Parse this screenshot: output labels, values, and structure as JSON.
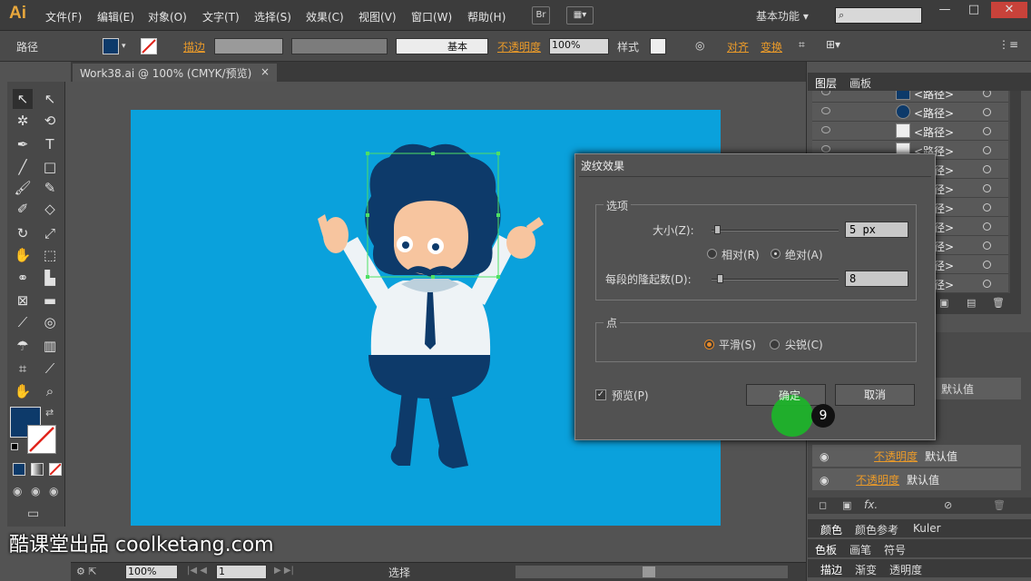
{
  "app": {
    "logo": "Ai",
    "menus": [
      "文件(F)",
      "编辑(E)",
      "对象(O)",
      "文字(T)",
      "选择(S)",
      "效果(C)",
      "视图(V)",
      "窗口(W)",
      "帮助(H)"
    ],
    "bridge_label": "Br",
    "workspace": "基本功能",
    "window_controls": [
      "—",
      "□",
      "✕"
    ]
  },
  "control_bar": {
    "selection_type": "路径",
    "stroke_label": "描边",
    "stroke_style": "基本",
    "opacity_label": "不透明度",
    "opacity_value": "100%",
    "style_label": "样式",
    "align_label": "对齐",
    "transform_label": "变换"
  },
  "document": {
    "tab_title": "Work38.ai @ 100% (CMYK/预览)",
    "tab_close": "×"
  },
  "status": {
    "zoom": "100%",
    "page": "1",
    "tool": "选择"
  },
  "watermark": "酷课堂出品 coolketang.com",
  "layers_panel": {
    "tabs": [
      "图层",
      "画板"
    ],
    "rows": [
      {
        "name": "<路径>"
      },
      {
        "name": "<路径>"
      },
      {
        "name": "<路径>"
      },
      {
        "name": "<路径>"
      },
      {
        "name": "<路径>"
      },
      {
        "name": "<路径>"
      },
      {
        "name": "<路径>"
      },
      {
        "name": "<路径>"
      },
      {
        "name": "<路径>"
      },
      {
        "name": "<路径>"
      },
      {
        "name": "<路径>"
      }
    ]
  },
  "appearance_panel": {
    "rows": [
      {
        "label": "",
        "value": "默认值"
      },
      {
        "label": "不透明度",
        "value": "默认值"
      },
      {
        "label": "不透明度",
        "value": "默认值"
      }
    ],
    "fx_label": "fx."
  },
  "color_panels": {
    "row1": [
      "颜色",
      "颜色参考",
      "Kuler"
    ],
    "row2": [
      "色板",
      "画笔",
      "符号"
    ],
    "row3": [
      "描边",
      "渐变",
      "透明度"
    ]
  },
  "dialog": {
    "title": "波纹效果",
    "options_group": "选项",
    "size_label": "大小(Z):",
    "size_value": "5 px",
    "relative_label": "相对(R)",
    "absolute_label": "绝对(A)",
    "ridges_label": "每段的隆起数(D):",
    "ridges_value": "8",
    "points_group": "点",
    "smooth_label": "平滑(S)",
    "corner_label": "尖锐(C)",
    "preview_label": "预览(P)",
    "ok_label": "确定",
    "cancel_label": "取消",
    "step_badge": "9"
  },
  "colors": {
    "canvas_bg": "#0aa1dc",
    "hair": "#0d3a6a",
    "skin": "#f7c59f",
    "highlight_green": "#1db32a",
    "accent_orange": "#e99a2a"
  }
}
